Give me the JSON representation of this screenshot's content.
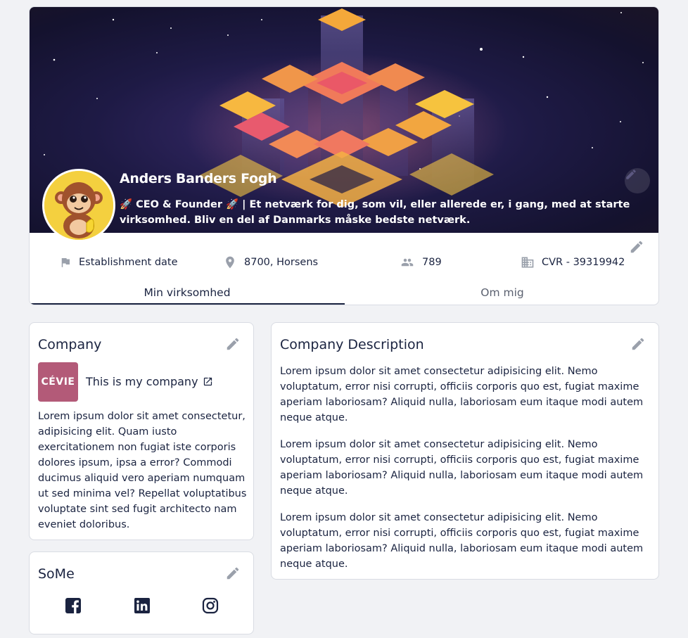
{
  "profile": {
    "name": "Anders Banders Fogh",
    "bio": "🚀 CEO & Founder 🚀 | Et netværk for dig, som vil, eller allerede er, i gang, med at starte virksomhed. Bliv en del af Danmarks måske bedste netværk."
  },
  "info": {
    "establishment": "Establishment date",
    "location": "8700, Horsens",
    "members": "789",
    "cvr": "CVR - 39319942"
  },
  "tabs": {
    "active": "Min virksomhed",
    "inactive": "Om mig"
  },
  "company": {
    "title": "Company",
    "logo_text": "CÉVIE",
    "link_text": "This is my company",
    "description": "Lorem ipsum dolor sit amet consectetur, adipisicing elit. Quam iusto exercitationem non fugiat iste corporis dolores ipsum, ipsa a error? Commodi ducimus aliquid vero aperiam numquam ut sed minima vel? Repellat voluptatibus voluptate sint sed fugit architecto nam eveniet doloribus."
  },
  "company_description": {
    "title": "Company Description",
    "paragraphs": [
      "Lorem ipsum dolor sit amet consectetur adipisicing elit. Nemo voluptatum, error nisi corrupti, officiis corporis quo est, fugiat maxime aperiam laboriosam? Aliquid nulla, laboriosam eum itaque modi autem neque atque.",
      "Lorem ipsum dolor sit amet consectetur adipisicing elit. Nemo voluptatum, error nisi corrupti, officiis corporis quo est, fugiat maxime aperiam laboriosam? Aliquid nulla, laboriosam eum itaque modi autem neque atque.",
      "Lorem ipsum dolor sit amet consectetur adipisicing elit. Nemo voluptatum, error nisi corrupti, officiis corporis quo est, fugiat maxime aperiam laboriosam? Aliquid nulla, laboriosam eum itaque modi autem neque atque."
    ]
  },
  "some": {
    "title": "SoMe",
    "icons": [
      "facebook-icon",
      "linkedin-icon",
      "instagram-icon"
    ]
  },
  "colors": {
    "primary_text": "#1a2340",
    "muted_icon": "#9aa0ab",
    "logo_bg": "#b35a78",
    "avatar_bg": "#f4d03f"
  }
}
